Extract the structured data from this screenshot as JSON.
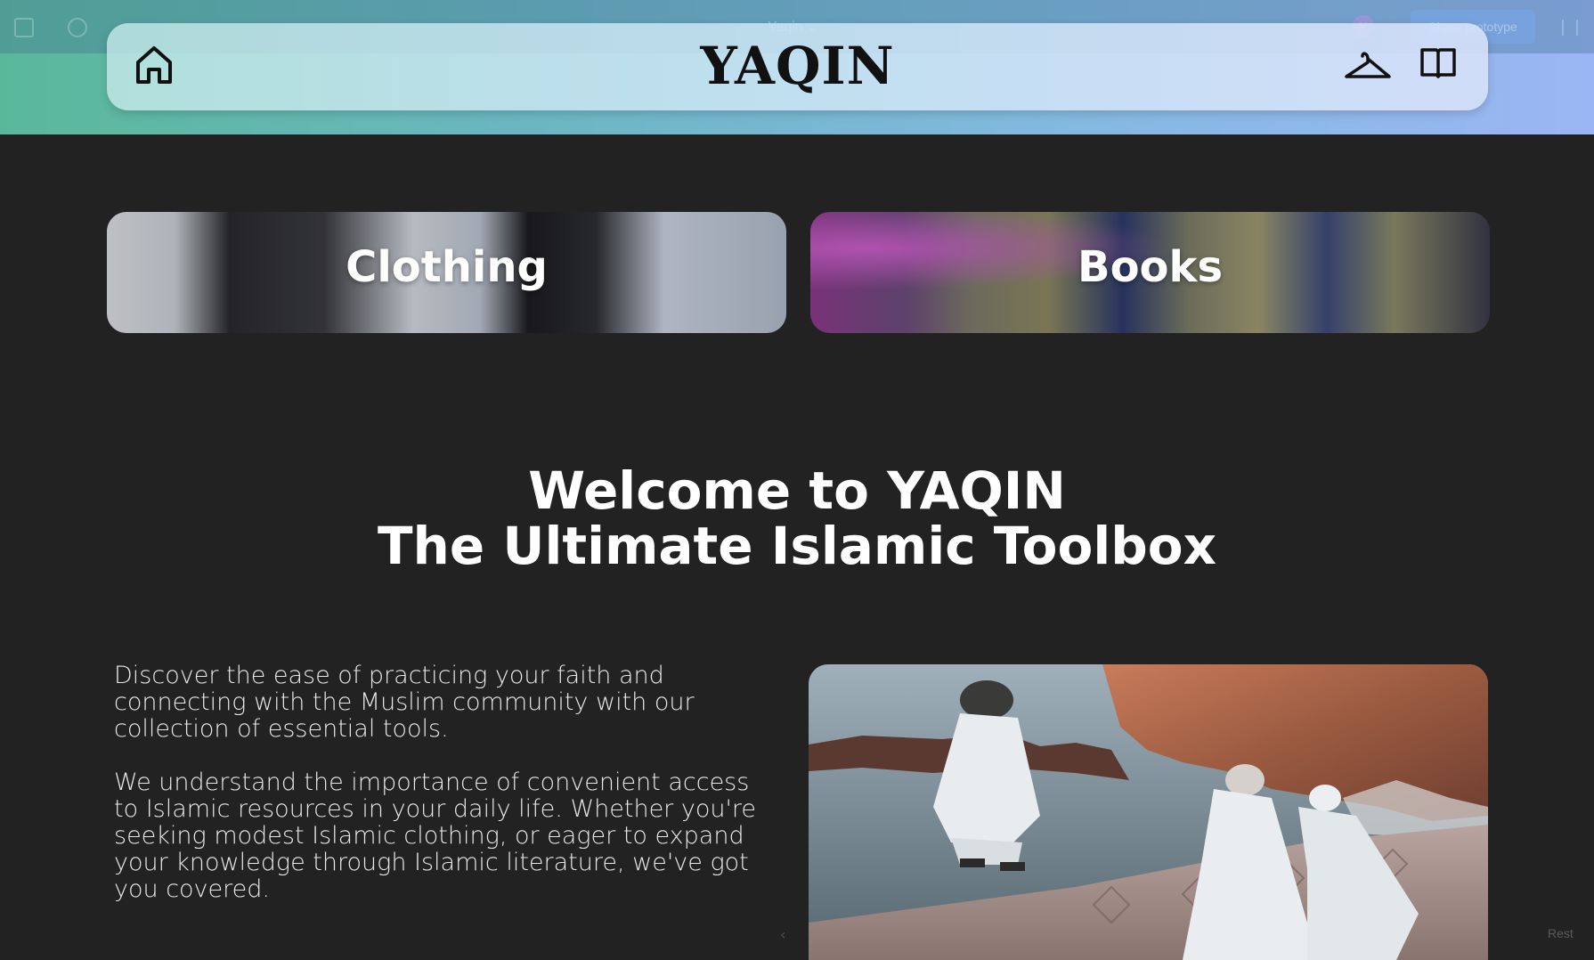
{
  "editor": {
    "file_title": "Yaqin",
    "title_caret": "⌄",
    "avatar_initial": "Y",
    "share_label": "Share prototype",
    "restart_label": "Rest",
    "prev_arrow": "‹"
  },
  "header": {
    "brand": "YAQIN",
    "icons": [
      "home-icon",
      "hanger-icon",
      "book-icon"
    ]
  },
  "categories": [
    {
      "label": "Clothing"
    },
    {
      "label": "Books"
    }
  ],
  "welcome": {
    "line1": "Welcome to YAQIN",
    "line2": "The Ultimate Islamic Toolbox"
  },
  "description": {
    "paragraph1": "Discover the ease of practicing your faith and connecting with the Muslim community with our collection of essential tools.",
    "paragraph2": "We understand the importance of convenient access to Islamic resources in your daily life. Whether you're seeking modest Islamic clothing, or eager to expand your knowledge through Islamic literature, we've got you covered."
  },
  "colors": {
    "background": "#232223",
    "gradient_start": "#5ab89a",
    "gradient_end": "#9bb6f4",
    "brand_text": "#111111"
  }
}
